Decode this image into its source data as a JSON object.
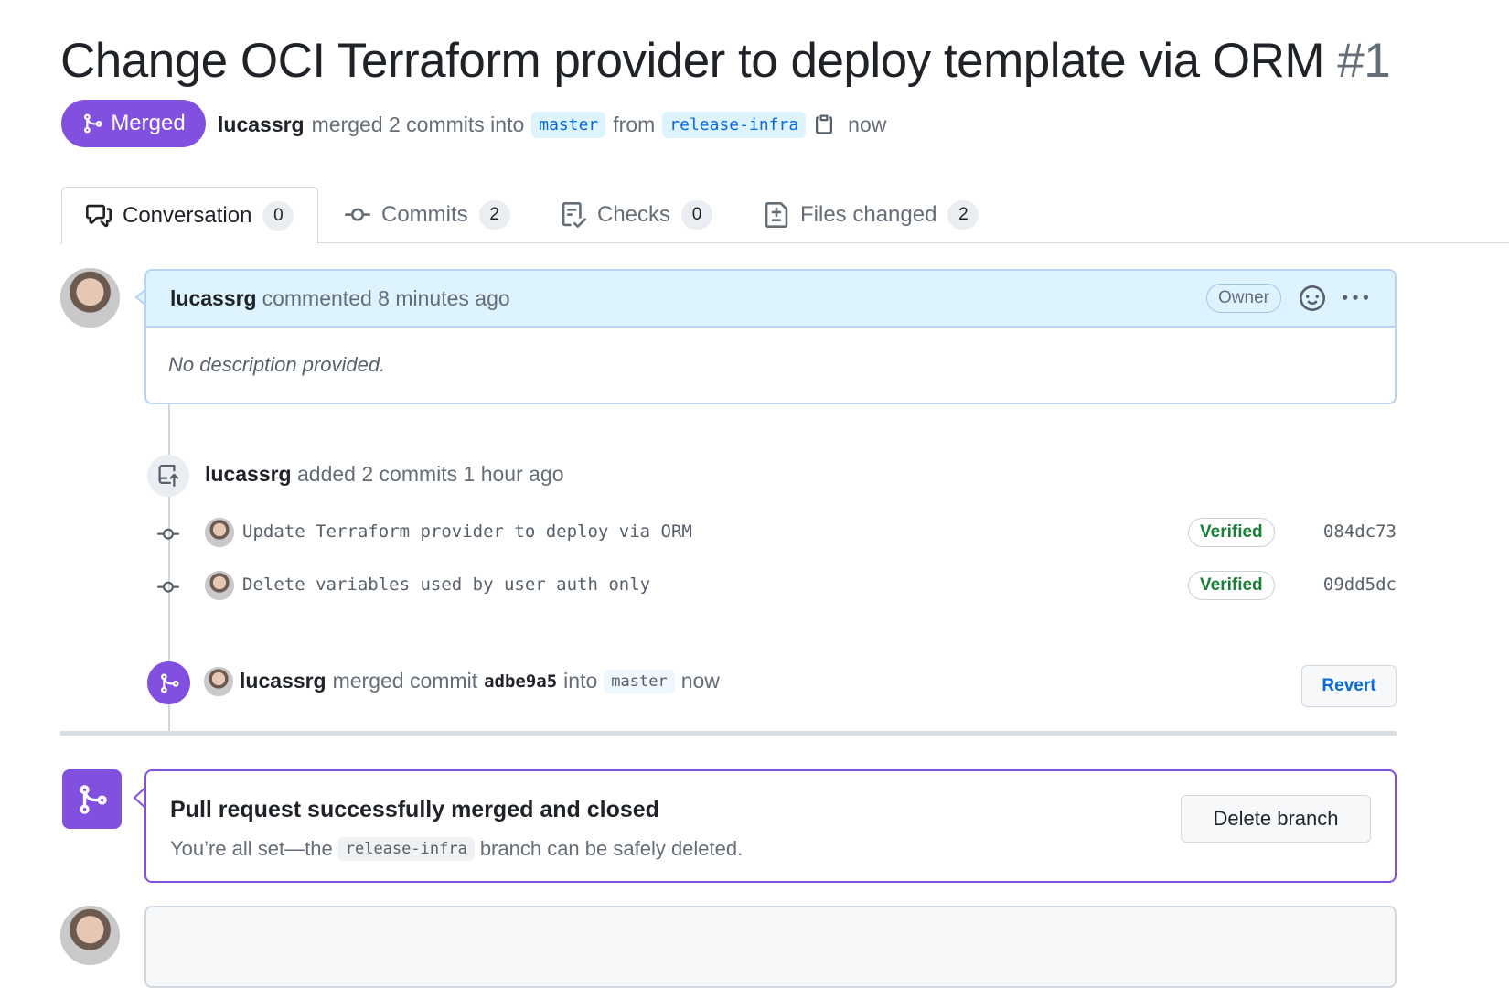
{
  "pr": {
    "title": "Change OCI Terraform provider to deploy template via ORM",
    "number": "#1",
    "state_label": "Merged",
    "author": "lucassrg",
    "merge_text": "merged 2 commits into",
    "base_branch": "master",
    "from_text": "from",
    "head_branch": "release-infra",
    "time": "now"
  },
  "tabs": [
    {
      "label": "Conversation",
      "count": "0",
      "icon": "comment-discussion-icon"
    },
    {
      "label": "Commits",
      "count": "2",
      "icon": "git-commit-icon"
    },
    {
      "label": "Checks",
      "count": "0",
      "icon": "checklist-icon"
    },
    {
      "label": "Files changed",
      "count": "2",
      "icon": "file-diff-icon"
    }
  ],
  "comment": {
    "author": "lucassrg",
    "action": "commented 8 minutes ago",
    "role": "Owner",
    "body": "No description provided."
  },
  "commits_event": {
    "author": "lucassrg",
    "text": "added 2 commits 1 hour ago",
    "commits": [
      {
        "message": "Update Terraform provider to deploy via ORM",
        "status": "Verified",
        "sha": "084dc73"
      },
      {
        "message": "Delete variables used by user auth only",
        "status": "Verified",
        "sha": "09dd5dc"
      }
    ]
  },
  "merge_event": {
    "author": "lucassrg",
    "text_a": "merged commit",
    "sha": "adbe9a5",
    "text_b": "into",
    "branch": "master",
    "time": "now",
    "revert_label": "Revert"
  },
  "merged_box": {
    "heading": "Pull request successfully merged and closed",
    "text_a": "You’re all set—the",
    "branch": "release-infra",
    "text_b": "branch can be safely deleted.",
    "delete_label": "Delete branch"
  },
  "colors": {
    "merged_purple": "#8250df",
    "link_blue": "#0969da",
    "verified_green": "#1a7f37"
  }
}
